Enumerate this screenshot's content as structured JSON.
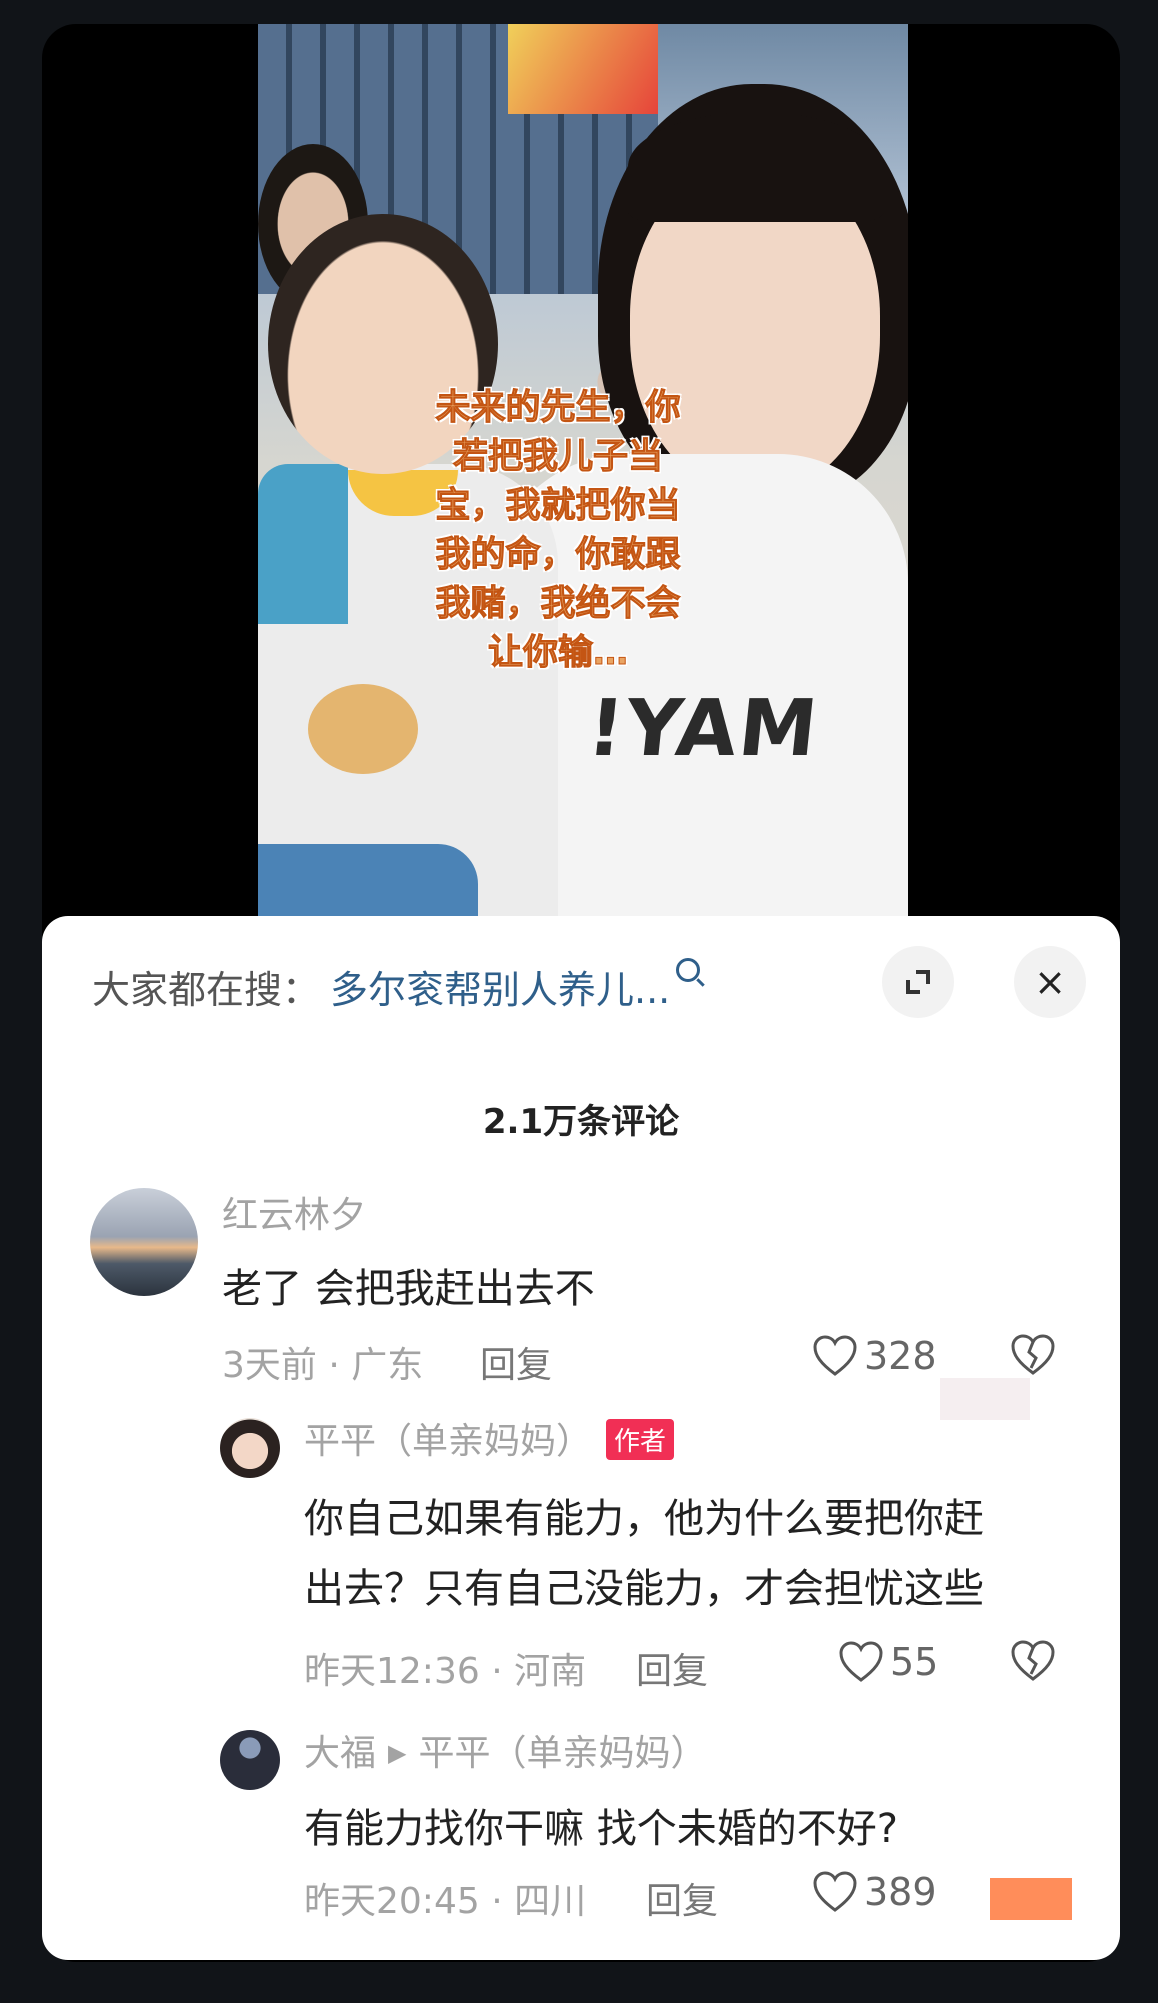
{
  "video": {
    "caption_lines": [
      "未来的先生，你",
      "若把我儿子当",
      "宝，我就把你当",
      "我的命，你敢跟",
      "我赌，我绝不会",
      "让你输…"
    ],
    "shirt_text": "!YAM"
  },
  "search": {
    "label": "大家都在搜：",
    "term": "多尔衮帮别人养儿...",
    "icon": "search-icon"
  },
  "buttons": {
    "expand_icon": "expand-icon",
    "close_label": "×"
  },
  "comment_count": "2.1万条评论",
  "comments": [
    {
      "user": "红云林夕",
      "text": "老了 会把我赶出去不",
      "meta": "3天前 · 广东",
      "reply": "回复",
      "likes": "328"
    }
  ],
  "replies": [
    {
      "user": "平平（单亲妈妈）",
      "tag": "作者",
      "text_lines": [
        "你自己如果有能力，他为什么要把你赶",
        "出去？只有自己没能力，才会担忧这些"
      ],
      "meta": "昨天12:36 · 河南",
      "reply": "回复",
      "likes": "55"
    },
    {
      "user": "大福",
      "reply_to": "平平（单亲妈妈）",
      "text": "有能力找你干嘛  找个未婚的不好?",
      "meta": "昨天20:45 · 四川",
      "reply": "回复",
      "likes": "389"
    }
  ],
  "colors": {
    "accent_link": "#2f5f8a",
    "author_tag": "#f12f55",
    "caption": "#e9a463"
  }
}
